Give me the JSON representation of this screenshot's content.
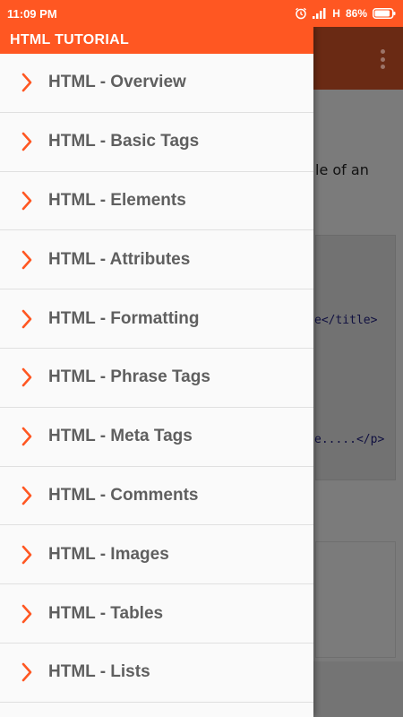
{
  "status_bar": {
    "time": "11:09 PM",
    "network": "H",
    "battery": "86%",
    "icons": [
      "alarm-icon",
      "signal-icon",
      "battery-icon"
    ]
  },
  "drawer": {
    "title": "HTML TUTORIAL",
    "items": [
      {
        "label": "HTML - Overview"
      },
      {
        "label": "HTML - Basic Tags"
      },
      {
        "label": "HTML - Elements"
      },
      {
        "label": "HTML - Attributes"
      },
      {
        "label": "HTML - Formatting"
      },
      {
        "label": "HTML - Phrase Tags"
      },
      {
        "label": "HTML - Meta Tags"
      },
      {
        "label": "HTML - Comments"
      },
      {
        "label": "HTML - Images"
      },
      {
        "label": "HTML - Tables"
      },
      {
        "label": "HTML - Lists"
      }
    ]
  },
  "background": {
    "text_fragment": "le of an",
    "code_line_1": "e</title>",
    "code_line_2": "e.....</p>"
  },
  "colors": {
    "accent": "#ff5722",
    "chevron": "#ff5722",
    "item_text": "#5f5f5f",
    "drawer_bg": "#fafafa"
  }
}
